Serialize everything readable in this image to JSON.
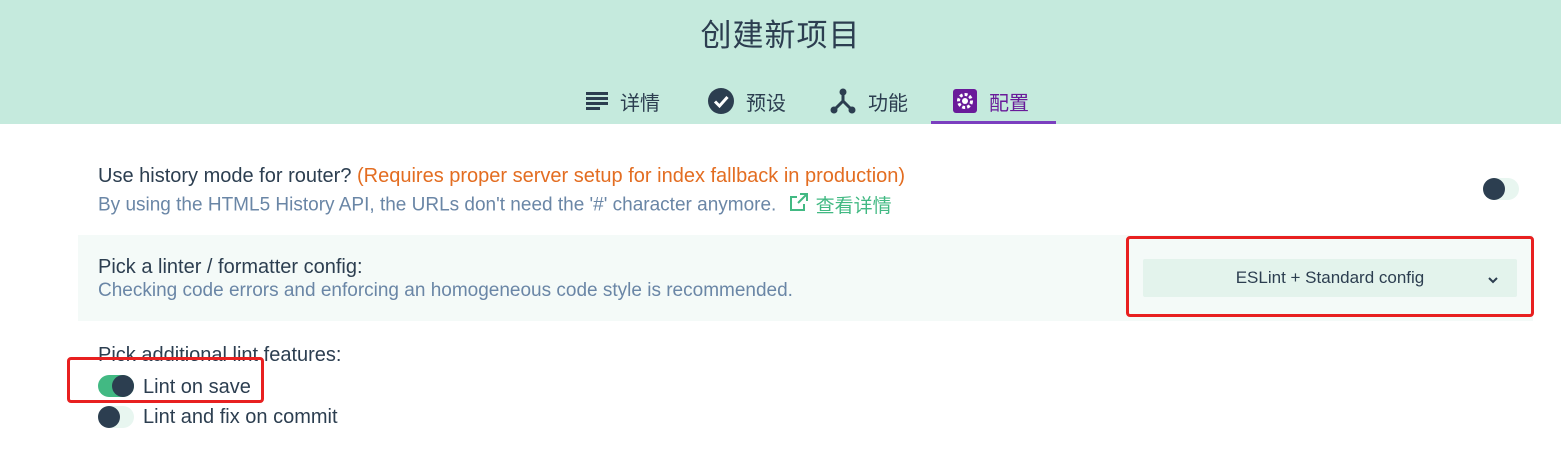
{
  "header": {
    "title": "创建新项目",
    "tabs": [
      {
        "label": "详情",
        "icon": "list-icon"
      },
      {
        "label": "预设",
        "icon": "check-circle-icon"
      },
      {
        "label": "功能",
        "icon": "fork-icon"
      },
      {
        "label": "配置",
        "icon": "gear-icon",
        "active": true
      }
    ]
  },
  "router": {
    "label": "Use history mode for router?",
    "warning": "(Requires proper server setup for index fallback in production)",
    "description": "By using the HTML5 History API, the URLs don't need the '#' character anymore.",
    "link_label": "查看详情",
    "enabled": false
  },
  "linter": {
    "label": "Pick a linter / formatter config:",
    "description": "Checking code errors and enforcing an homogeneous code style is recommended.",
    "selected": "ESLint + Standard config"
  },
  "lint_features": {
    "label": "Pick additional lint features:",
    "items": [
      {
        "label": "Lint on save",
        "enabled": true
      },
      {
        "label": "Lint and fix on commit",
        "enabled": false
      }
    ]
  },
  "colors": {
    "header_bg": "#c5eadd",
    "accent": "#42b983",
    "active_tab": "#7b3fbf",
    "warning": "#e36d21",
    "highlight": "#e82020"
  }
}
